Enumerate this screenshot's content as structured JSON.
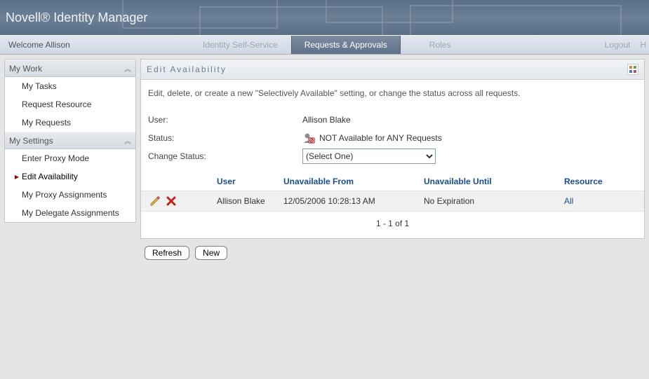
{
  "banner": {
    "title": "Novell® Identity Manager"
  },
  "header": {
    "welcome": "Welcome Allison",
    "tabs": {
      "self_service": "Identity Self-Service",
      "requests": "Requests & Approvals",
      "roles": "Roles"
    },
    "logout": "Logout",
    "help_initial": "H"
  },
  "sidebar": {
    "groups": [
      {
        "title": "My Work",
        "items": [
          "My Tasks",
          "Request Resource",
          "My Requests"
        ],
        "active_index": null
      },
      {
        "title": "My Settings",
        "items": [
          "Enter Proxy Mode",
          "Edit Availability",
          "My Proxy Assignments",
          "My Delegate Assignments"
        ],
        "active_index": 1
      }
    ]
  },
  "panel": {
    "title": "Edit Availability",
    "description": "Edit, delete, or create a new \"Selectively Available\" setting, or change the status across all requests.",
    "form": {
      "user_label": "User:",
      "user_value": "Allison Blake",
      "status_label": "Status:",
      "status_value": "NOT Available for ANY Requests",
      "change_status_label": "Change Status:",
      "change_status_select": "(Select One)"
    },
    "table": {
      "columns": {
        "actions": "",
        "user": "User",
        "from": "Unavailable From",
        "until": "Unavailable Until",
        "resource": "Resource"
      },
      "rows": [
        {
          "user": "Allison Blake",
          "from": "12/05/2006 10:28:13 AM",
          "until": "No Expiration",
          "resource": "All"
        }
      ],
      "pager": "1 - 1 of 1"
    },
    "buttons": {
      "refresh": "Refresh",
      "new": "New"
    }
  }
}
